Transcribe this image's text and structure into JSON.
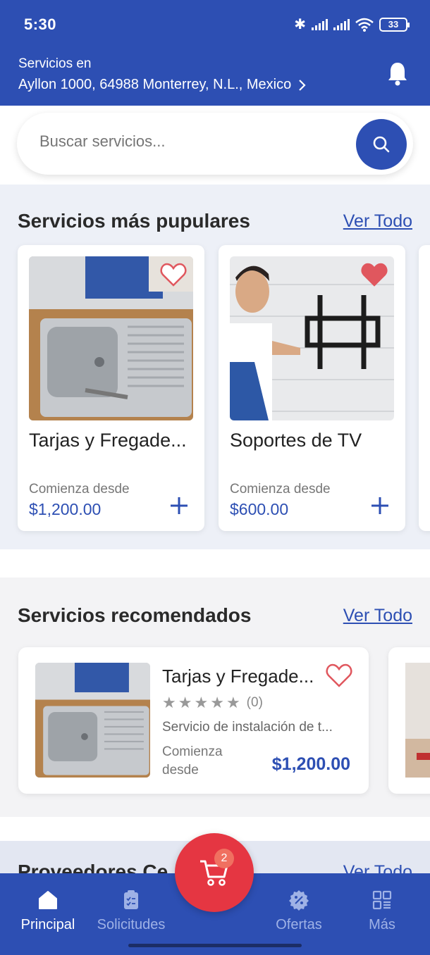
{
  "status_bar": {
    "time": "5:30",
    "battery": "33"
  },
  "header": {
    "location_label": "Servicios en",
    "address": "Ayllon 1000, 64988 Monterrey, N.L., Mexico"
  },
  "search": {
    "placeholder": "Buscar servicios..."
  },
  "popular": {
    "title": "Servicios más pupulares",
    "see_all": "Ver Todo",
    "items": [
      {
        "title": "Tarjas y Fregade...",
        "from_label": "Comienza desde",
        "price": "$1,200.00",
        "favorited": false
      },
      {
        "title": "Soportes de TV",
        "from_label": "Comienza desde",
        "price": "$600.00",
        "favorited": true
      }
    ]
  },
  "recommended": {
    "title": "Servicios recomendados",
    "see_all": "Ver Todo",
    "items": [
      {
        "title": "Tarjas y Fregade...",
        "rating_count": "(0)",
        "description": "Servicio de instalación de t...",
        "from_label": "Comienza desde",
        "price": "$1,200.00",
        "stars": 5
      }
    ]
  },
  "providers": {
    "title": "Proveedores Ce",
    "see_all": "Ver Todo"
  },
  "cart": {
    "count": "2"
  },
  "bottom_nav": {
    "items": [
      {
        "label": "Principal",
        "icon": "home-icon",
        "active": true
      },
      {
        "label": "Solicitudes",
        "icon": "clipboard-icon",
        "active": false
      },
      {
        "label": "Ofertas",
        "icon": "discount-icon",
        "active": false
      },
      {
        "label": "Más",
        "icon": "grid-icon",
        "active": false
      }
    ]
  },
  "colors": {
    "primary": "#2d4fb3",
    "accent": "#e53642",
    "heart": "#e0575e"
  }
}
